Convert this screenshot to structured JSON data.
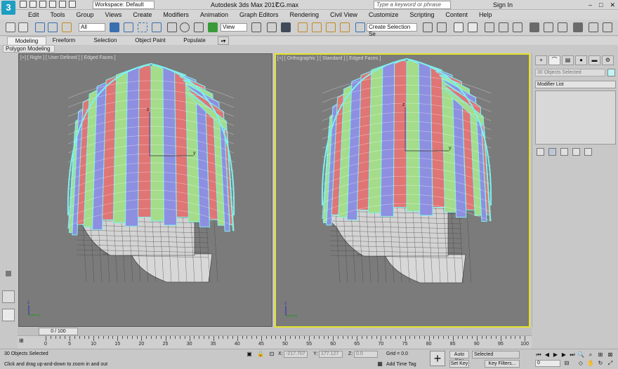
{
  "title_bar": {
    "app_logo": "3",
    "workspace": "Workspace: Default",
    "app_title": "Autodesk 3ds Max 2017",
    "file_name": "CG.max",
    "search_placeholder": "Type a keyword or phrase",
    "sign_in": "Sign In",
    "controls": [
      "–",
      "□",
      "✕"
    ]
  },
  "menu": [
    "Edit",
    "Tools",
    "Group",
    "Views",
    "Create",
    "Modifiers",
    "Animation",
    "Graph Editors",
    "Rendering",
    "Civil View",
    "Customize",
    "Scripting",
    "Content",
    "Help"
  ],
  "toolbar": {
    "selection_filter": "All",
    "reference_coord": "View",
    "named_selection": "Create Selection Se",
    "icon_colors": [
      "#3a6fb0",
      "#3a9a3a",
      "#b03a3a",
      "#c48a20",
      "#6a6a6a"
    ]
  },
  "ribbon": {
    "tabs": [
      "Modeling",
      "Freeform",
      "Selection",
      "Object Paint",
      "Populate"
    ],
    "active_tab": "Modeling",
    "sub_label": "Polygon Modeling"
  },
  "viewports": {
    "left": {
      "label": "[+] [ Right ] [ User Defined ] [ Edged Faces ]",
      "active": false
    },
    "right": {
      "label": "[+] [ Orthographic ] [ Standard ] [ Edged Faces ]",
      "active": true
    },
    "stripe_colors": [
      "#e07575",
      "#a4dc8a",
      "#8e8fe0"
    ],
    "wire_color": "#7ff0f0",
    "axis_labels": {
      "x": "x",
      "y": "y",
      "z": "z"
    }
  },
  "command_panel": {
    "tabs": [
      "+",
      "⌒",
      "▤",
      "●",
      "▬",
      "⚙"
    ],
    "object_name": "30 Objects Selected",
    "modifier_list": "Modifier List",
    "object_color": "#bff5f5"
  },
  "timeline": {
    "slider": "0 / 100",
    "ticks": [
      "0",
      "5",
      "10",
      "15",
      "20",
      "25",
      "30",
      "35",
      "40",
      "45",
      "50",
      "55",
      "60",
      "65",
      "70",
      "75",
      "80",
      "85",
      "90",
      "95",
      "100"
    ]
  },
  "status": {
    "selected": "30 Objects Selected",
    "prompt": "Click and drag up-and-down to zoom in and out",
    "x_label": "X:",
    "x_value": "-217.707",
    "y_label": "Y:",
    "y_value": "177.127",
    "z_label": "Z:",
    "z_value": "0.0",
    "grid": "Grid = 0.0",
    "add_time_tag": "Add Time Tag",
    "auto_key": "Auto Key",
    "set_key": "Set Key",
    "key_mode": "Selected",
    "key_filters": "Key Filters...",
    "frame": "0"
  }
}
